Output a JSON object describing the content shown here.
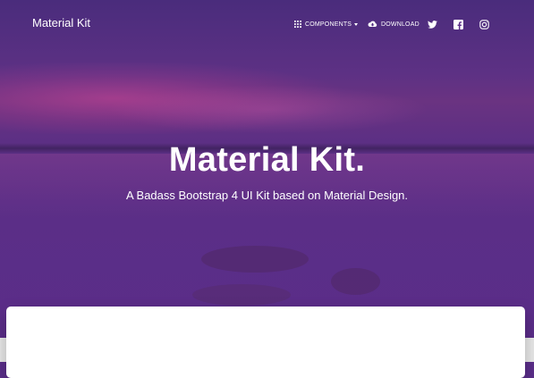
{
  "navbar": {
    "brand": "Material Kit",
    "items": [
      {
        "label": "COMPONENTS",
        "icon": "apps-grid-icon",
        "has_caret": true
      },
      {
        "label": "DOWNLOAD",
        "icon": "cloud-download-icon"
      },
      {
        "label": "",
        "icon": "twitter-icon"
      },
      {
        "label": "",
        "icon": "facebook-icon"
      },
      {
        "label": "",
        "icon": "instagram-icon"
      }
    ]
  },
  "hero": {
    "title": "Material Kit.",
    "subtitle": "A Badass Bootstrap 4 UI Kit based on Material Design."
  },
  "colors": {
    "overlay": "#5b2e89",
    "text": "#ffffff",
    "card": "#ffffff"
  }
}
